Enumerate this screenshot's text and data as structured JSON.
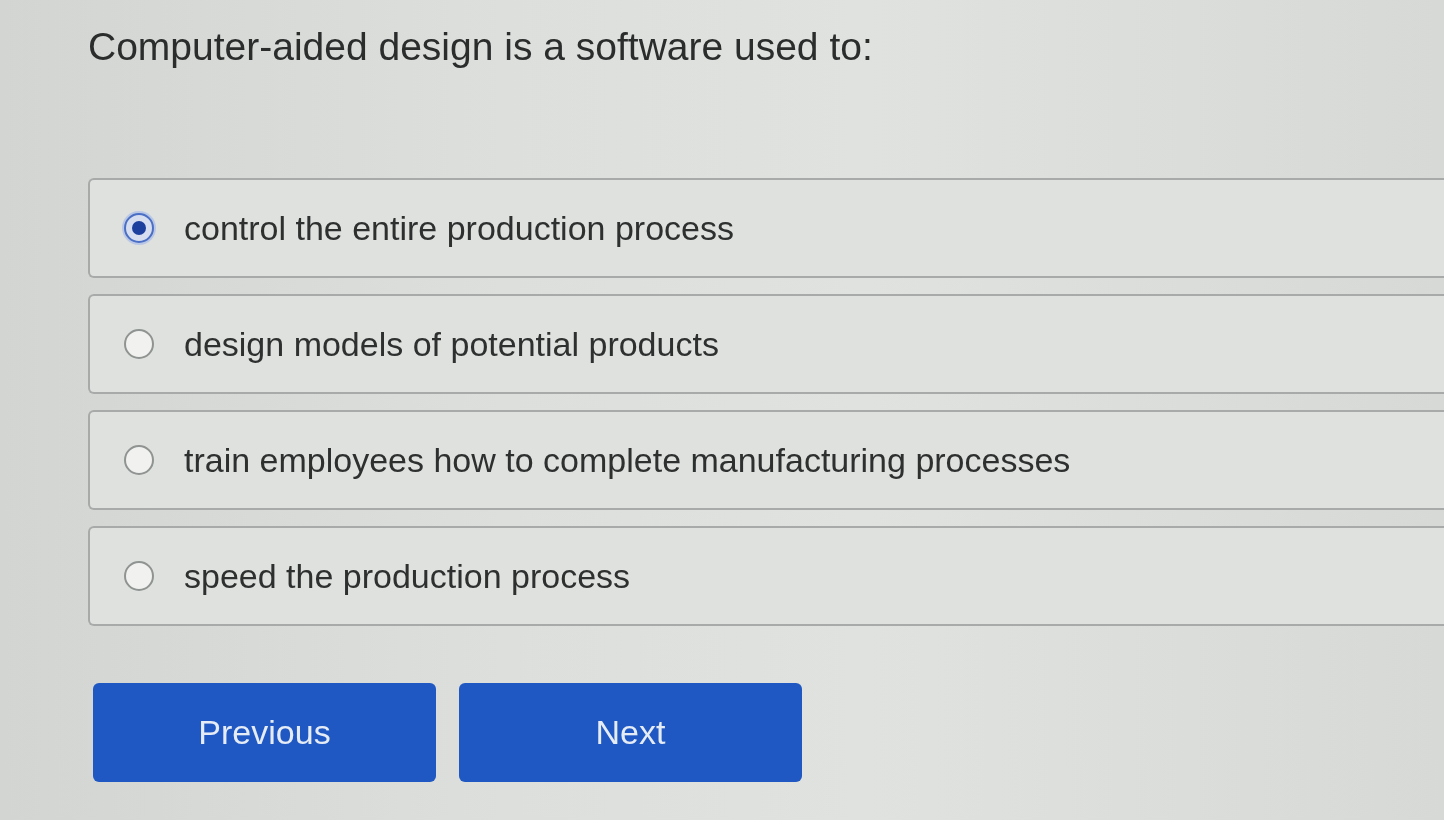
{
  "question": {
    "text": "Computer-aided design is a software used to:"
  },
  "options": [
    {
      "label": "control the entire production process",
      "selected": true
    },
    {
      "label": "design models of potential products",
      "selected": false
    },
    {
      "label": "train employees how to complete manufacturing processes",
      "selected": false
    },
    {
      "label": "speed the production process",
      "selected": false
    }
  ],
  "buttons": [
    {
      "label": "Previous"
    },
    {
      "label": "Next"
    }
  ]
}
